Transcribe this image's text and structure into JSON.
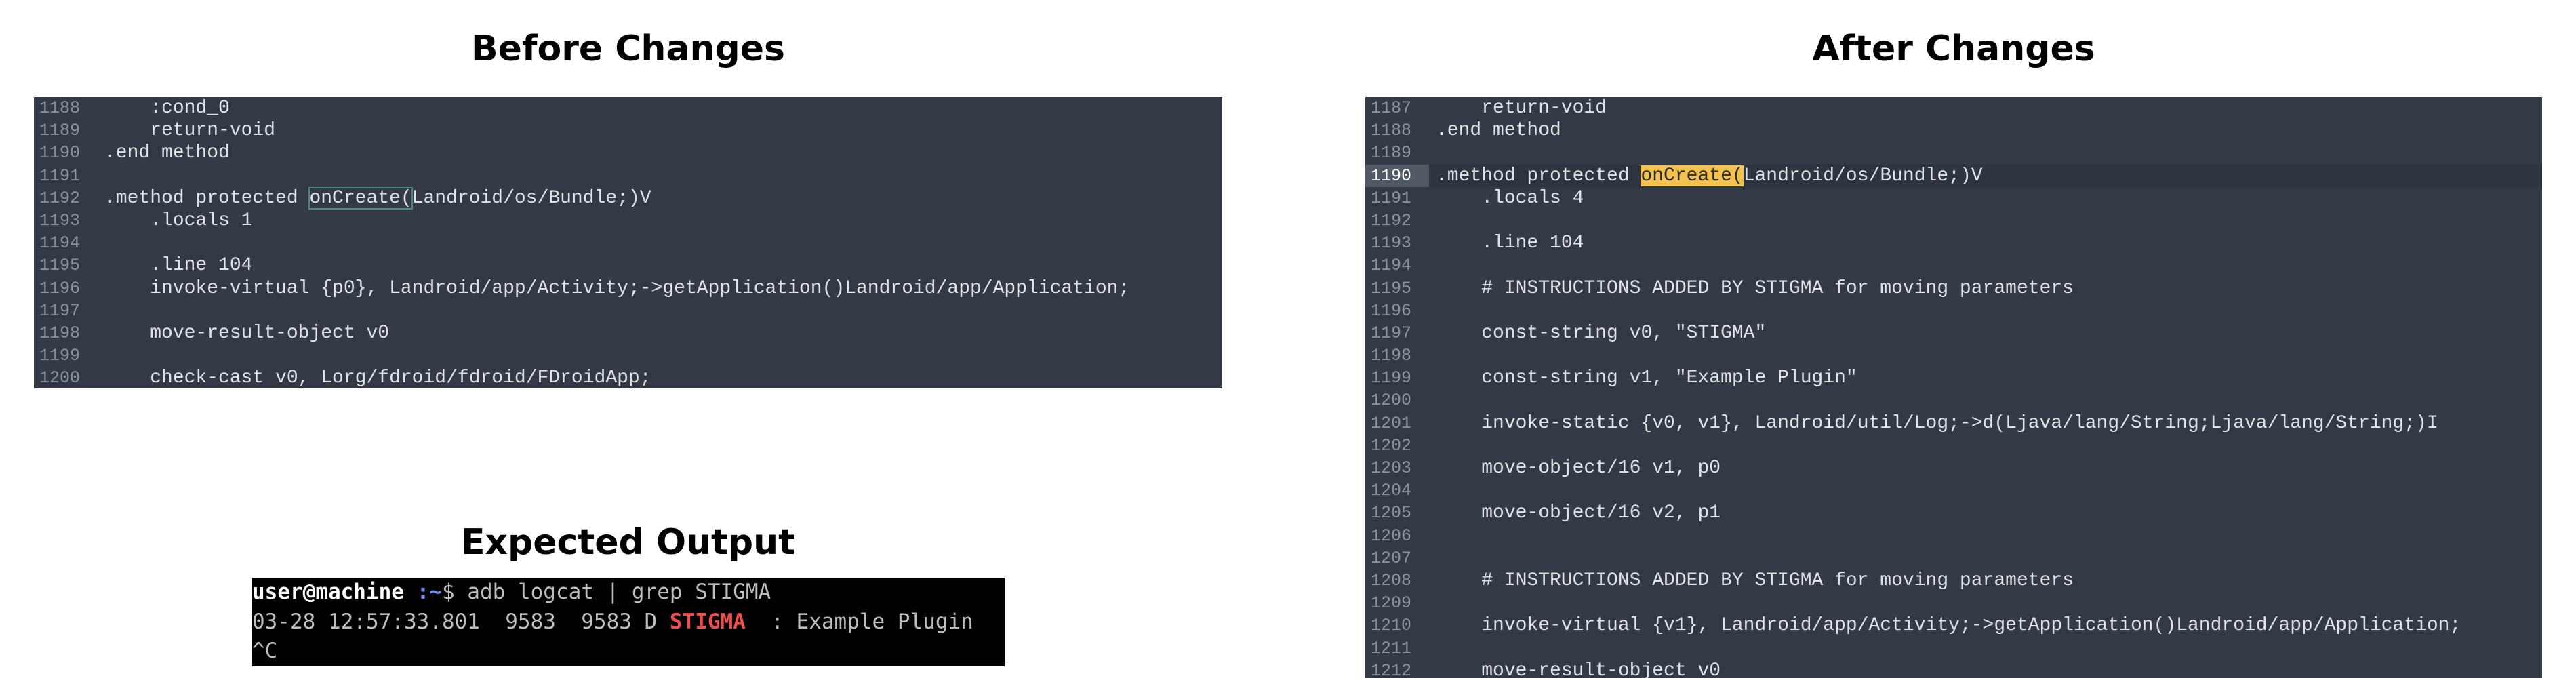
{
  "colors": {
    "page_bg": "#ffffff",
    "code_bg": "#333a45",
    "code_text": "#dfe3e8",
    "line_number": "#8b939c",
    "highlight_fill": "#f2c14e",
    "highlight_outline": "#4b8a80",
    "terminal_bg": "#000000",
    "terminal_tag": "#ef4e4e",
    "terminal_path": "#6c8df5"
  },
  "before": {
    "title": "Before Changes",
    "lines": [
      {
        "n": "1188",
        "pre": "    :cond_0"
      },
      {
        "n": "1189",
        "pre": "    return-void"
      },
      {
        "n": "1190",
        "pre": ".end method"
      },
      {
        "n": "1191",
        "pre": ""
      },
      {
        "n": "1192",
        "pre": ".method protected ",
        "hl": "onCreate(",
        "post": "Landroid/os/Bundle;)V"
      },
      {
        "n": "1193",
        "pre": "    .locals 1"
      },
      {
        "n": "1194",
        "pre": ""
      },
      {
        "n": "1195",
        "pre": "    .line 104"
      },
      {
        "n": "1196",
        "pre": "    invoke-virtual {p0}, Landroid/app/Activity;->getApplication()Landroid/app/Application;"
      },
      {
        "n": "1197",
        "pre": ""
      },
      {
        "n": "1198",
        "pre": "    move-result-object v0"
      },
      {
        "n": "1199",
        "pre": ""
      },
      {
        "n": "1200",
        "pre": "    check-cast v0, Lorg/fdroid/fdroid/FDroidApp;"
      }
    ]
  },
  "after": {
    "title": "After Changes",
    "lines": [
      {
        "n": "1187",
        "pre": "    return-void"
      },
      {
        "n": "1188",
        "pre": ".end method"
      },
      {
        "n": "1189",
        "pre": ""
      },
      {
        "n": "1190",
        "pre": ".method protected ",
        "hl": "onCreate(",
        "post": "Landroid/os/Bundle;)V",
        "active": true
      },
      {
        "n": "1191",
        "pre": "    .locals 4"
      },
      {
        "n": "1192",
        "pre": ""
      },
      {
        "n": "1193",
        "pre": "    .line 104"
      },
      {
        "n": "1194",
        "pre": ""
      },
      {
        "n": "1195",
        "pre": "    # INSTRUCTIONS ADDED BY STIGMA for moving parameters"
      },
      {
        "n": "1196",
        "pre": ""
      },
      {
        "n": "1197",
        "pre": "    const-string v0, \"STIGMA\""
      },
      {
        "n": "1198",
        "pre": ""
      },
      {
        "n": "1199",
        "pre": "    const-string v1, \"Example Plugin\""
      },
      {
        "n": "1200",
        "pre": ""
      },
      {
        "n": "1201",
        "pre": "    invoke-static {v0, v1}, Landroid/util/Log;->d(Ljava/lang/String;Ljava/lang/String;)I"
      },
      {
        "n": "1202",
        "pre": ""
      },
      {
        "n": "1203",
        "pre": "    move-object/16 v1, p0"
      },
      {
        "n": "1204",
        "pre": ""
      },
      {
        "n": "1205",
        "pre": "    move-object/16 v2, p1"
      },
      {
        "n": "1206",
        "pre": ""
      },
      {
        "n": "1207",
        "pre": ""
      },
      {
        "n": "1208",
        "pre": "    # INSTRUCTIONS ADDED BY STIGMA for moving parameters"
      },
      {
        "n": "1209",
        "pre": ""
      },
      {
        "n": "1210",
        "pre": "    invoke-virtual {v1}, Landroid/app/Activity;->getApplication()Landroid/app/Application;"
      },
      {
        "n": "1211",
        "pre": ""
      },
      {
        "n": "1212",
        "pre": "    move-result-object v0"
      }
    ]
  },
  "expected": {
    "title": "Expected Output",
    "terminal": {
      "user": "user@machine",
      "path": " :~",
      "prompt": "$ adb logcat | grep STIGMA",
      "log_prefix": "03-28 12:57:33.801  9583  9583 D ",
      "log_tag": "STIGMA",
      "log_suffix": "  : Example Plugin",
      "last_line": "^C"
    }
  }
}
